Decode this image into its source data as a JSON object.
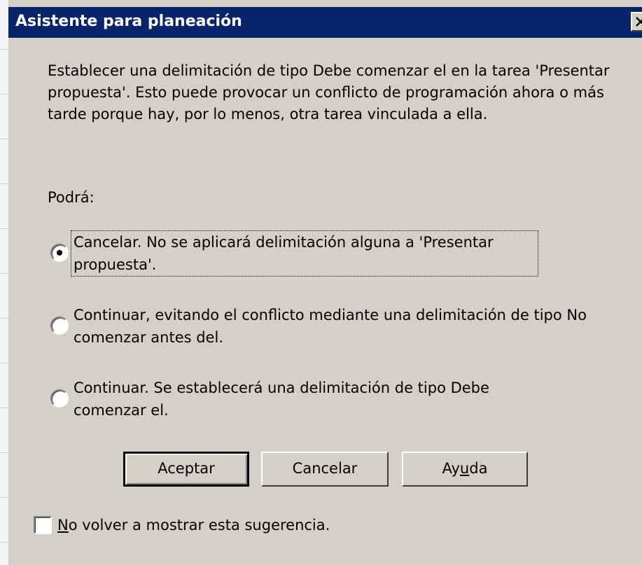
{
  "dialog": {
    "title": "Asistente para planeación",
    "message": "Establecer una delimitación de tipo Debe comenzar el en la tarea 'Presentar propuesta'. Esto puede provocar un conflicto de programación ahora o más tarde porque hay, por lo menos, otra tarea vinculada a ella.",
    "prompt": "Podrá:",
    "options": [
      {
        "label": "Cancelar. No se aplicará delimitación alguna a 'Presentar propuesta'.",
        "selected": true
      },
      {
        "label": "Continuar, evitando el conflicto mediante una delimitación de tipo No comenzar antes del.",
        "selected": false
      },
      {
        "label": "Continuar. Se establecerá una delimitación de tipo Debe comenzar el.",
        "selected": false
      }
    ],
    "buttons": {
      "ok": "Aceptar",
      "cancel": "Cancelar",
      "help_pre": "Ay",
      "help_mnemonic": "u",
      "help_post": "da"
    },
    "dont_show": {
      "mnemonic": "N",
      "rest": "o volver a mostrar esta sugerencia.",
      "checked": false
    }
  },
  "colors": {
    "titlebar": "#0a246a",
    "face": "#d4d0c8",
    "text": "#000000"
  },
  "icons": {
    "close": "close-icon"
  }
}
